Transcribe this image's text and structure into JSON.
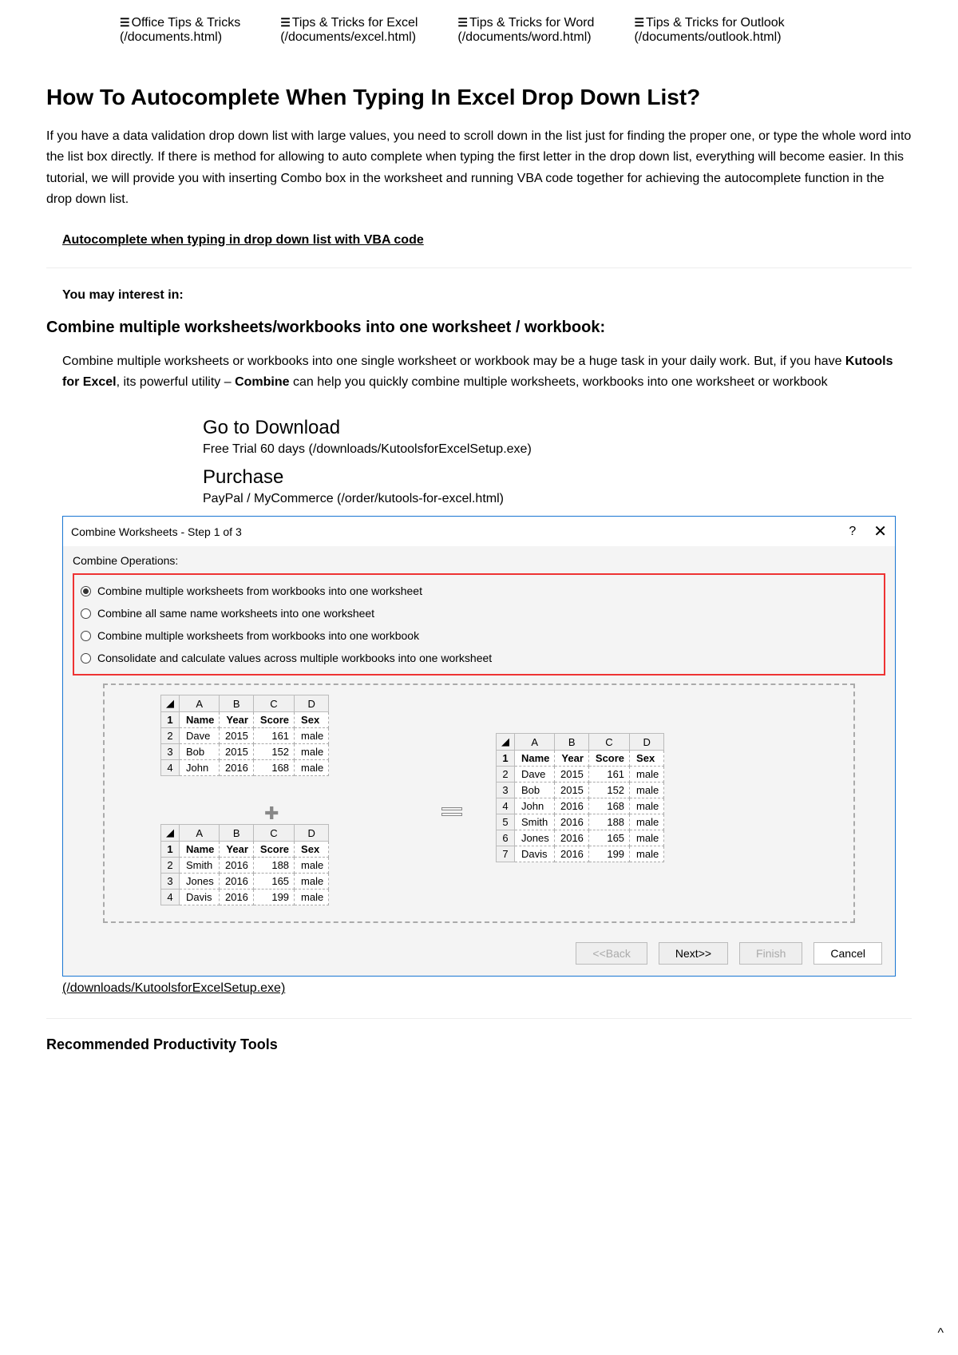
{
  "nav": [
    {
      "label1": "Office Tips & Tricks",
      "label2": "(/documents.html)"
    },
    {
      "label1": "Tips & Tricks for Excel",
      "label2": "(/documents/excel.html)"
    },
    {
      "label1": "Tips & Tricks for Word",
      "label2": "(/documents/word.html)"
    },
    {
      "label1": "Tips & Tricks for Outlook",
      "label2": "(/documents/outlook.html)"
    }
  ],
  "title": "How To Autocomplete When Typing In Excel Drop Down List?",
  "intro": "If you have a data validation drop down list with large values, you need to scroll down in the list just for finding the proper one, or type the whole word into the list box directly. If there is method for allowing to auto complete when typing the first letter in the drop down list, everything will become easier. In this tutorial, we will provide you with inserting Combo box in the worksheet and running VBA code together for achieving the autocomplete function in the drop down list.",
  "toc_link": "Autocomplete when typing in drop down list with VBA code",
  "interest_heading": "You may interest in:",
  "combine_heading": "Combine multiple worksheets/workbooks into one worksheet / workbook:",
  "combine_p_1": "Combine multiple worksheets or workbooks into one single worksheet or workbook may be a huge task in your daily work. But, if you have ",
  "combine_p_bold1": "Kutools for Excel",
  "combine_p_2": ", its powerful utility – ",
  "combine_p_bold2": "Combine",
  "combine_p_3": " can help you quickly combine multiple worksheets, workbooks into one worksheet or workbook",
  "dl": {
    "h1": "Go to Download",
    "s1": "Free Trial 60 days (/downloads/KutoolsforExcelSetup.exe)",
    "h2": "Purchase",
    "s2": "PayPal / MyCommerce (/order/kutools-for-excel.html)"
  },
  "dialog": {
    "title": "Combine Worksheets - Step 1 of 3",
    "help": "?",
    "close": "✕",
    "ops_label": "Combine Operations:",
    "ops": [
      "Combine multiple worksheets from workbooks into one worksheet",
      "Combine all same name worksheets into one worksheet",
      "Combine multiple worksheets from workbooks into one workbook",
      "Consolidate and calculate values across multiple workbooks into one worksheet"
    ],
    "cols": [
      "A",
      "B",
      "C",
      "D"
    ],
    "header": [
      "Name",
      "Year",
      "Score",
      "Sex"
    ],
    "t1": [
      [
        "Dave",
        "2015",
        "161",
        "male"
      ],
      [
        "Bob",
        "2015",
        "152",
        "male"
      ],
      [
        "John",
        "2016",
        "168",
        "male"
      ]
    ],
    "t2": [
      [
        "Smith",
        "2016",
        "188",
        "male"
      ],
      [
        "Jones",
        "2016",
        "165",
        "male"
      ],
      [
        "Davis",
        "2016",
        "199",
        "male"
      ]
    ],
    "t3": [
      [
        "Dave",
        "2015",
        "161",
        "male"
      ],
      [
        "Bob",
        "2015",
        "152",
        "male"
      ],
      [
        "John",
        "2016",
        "168",
        "male"
      ],
      [
        "Smith",
        "2016",
        "188",
        "male"
      ],
      [
        "Jones",
        "2016",
        "165",
        "male"
      ],
      [
        "Davis",
        "2016",
        "199",
        "male"
      ]
    ],
    "buttons": {
      "back": "<<Back",
      "next": "Next>>",
      "finish": "Finish",
      "cancel": "Cancel"
    }
  },
  "img_link": "(/downloads/KutoolsforExcelSetup.exe)",
  "rec_heading": "Recommended Productivity Tools",
  "caret": "^"
}
